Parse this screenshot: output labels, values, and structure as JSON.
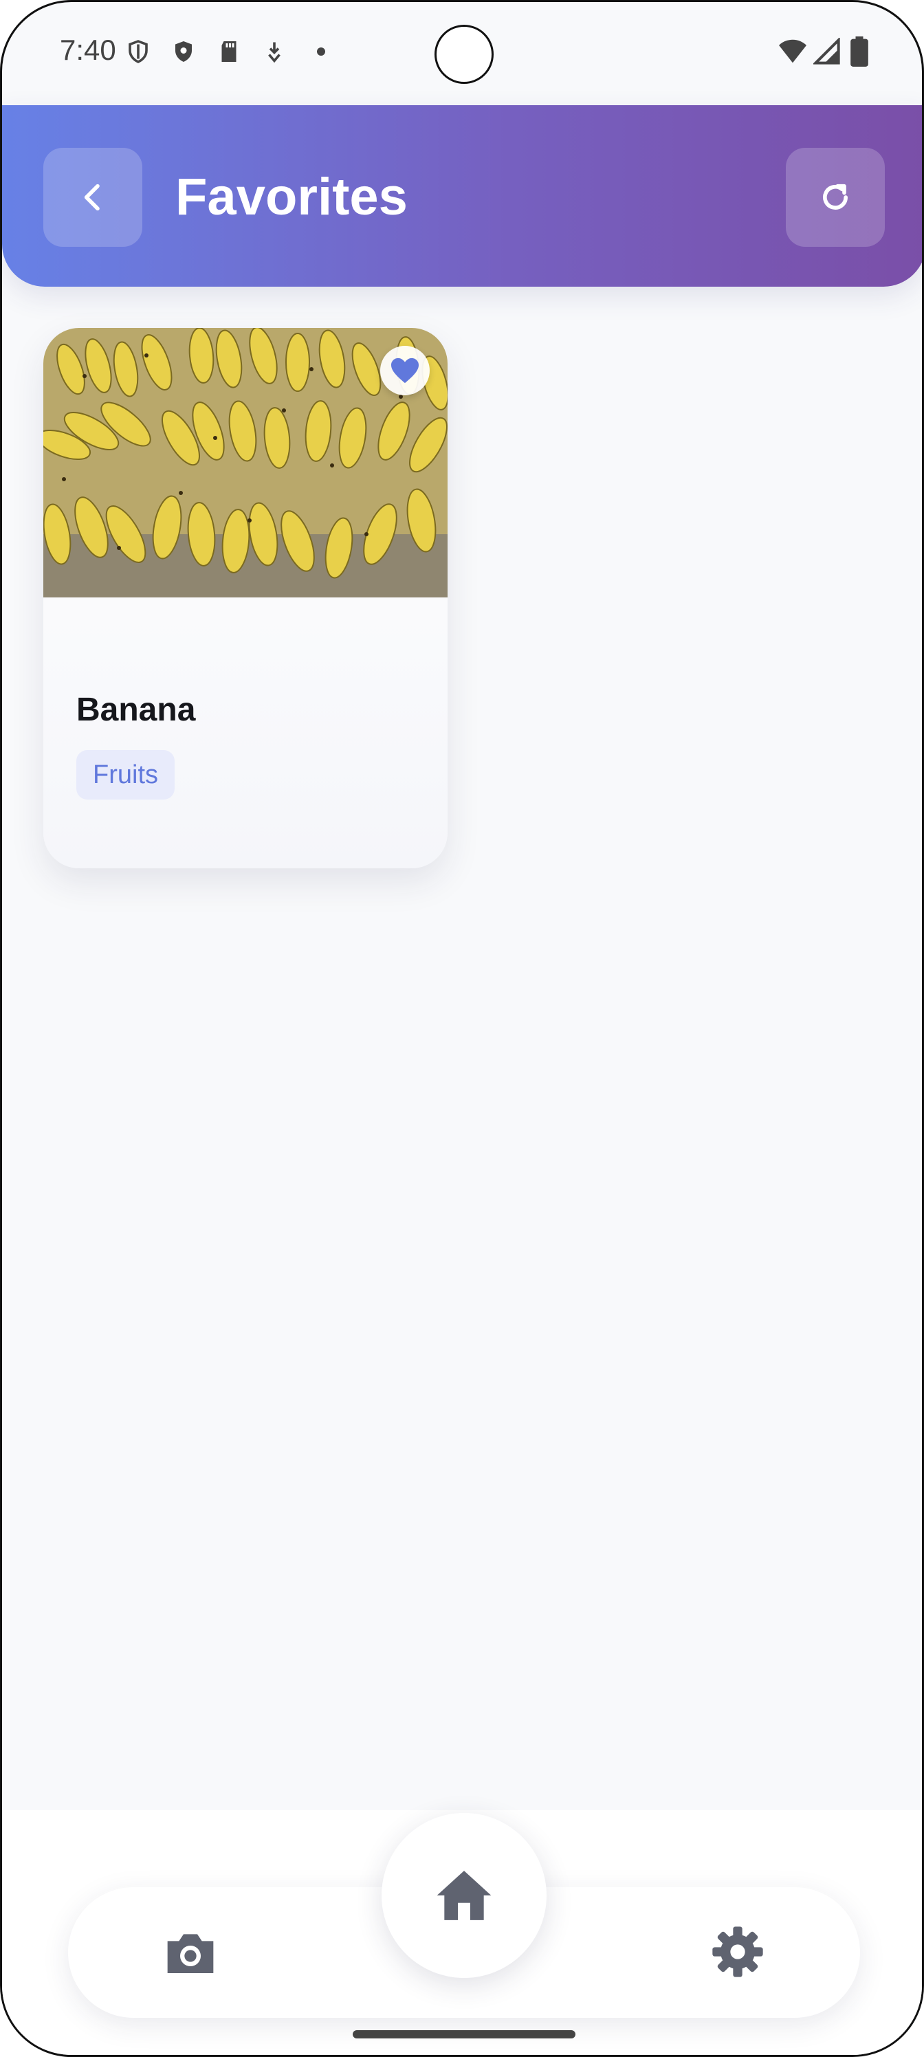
{
  "status_bar": {
    "time": "7:40",
    "left_icons": [
      "shield-outline-icon",
      "shield-icon",
      "sd-card-icon",
      "download-icon",
      "dot-icon"
    ],
    "right_icons": [
      "wifi-icon",
      "signal-icon",
      "battery-icon"
    ]
  },
  "header": {
    "title": "Favorites",
    "back_icon": "chevron-left-icon",
    "refresh_icon": "refresh-icon",
    "gradient_start": "#6781e6",
    "gradient_end": "#7a4fa8"
  },
  "favorites": [
    {
      "name": "Banana",
      "category": "Fruits",
      "image": "bananas-photo",
      "favorited": true
    }
  ],
  "bottom_nav": {
    "items": [
      "camera-icon",
      "home-icon",
      "settings-icon"
    ],
    "active": "home-icon"
  },
  "colors": {
    "accent": "#6078dc",
    "tag_bg": "#e8ebfb",
    "background": "#f8f9fb",
    "nav_icon": "#5f6370"
  }
}
